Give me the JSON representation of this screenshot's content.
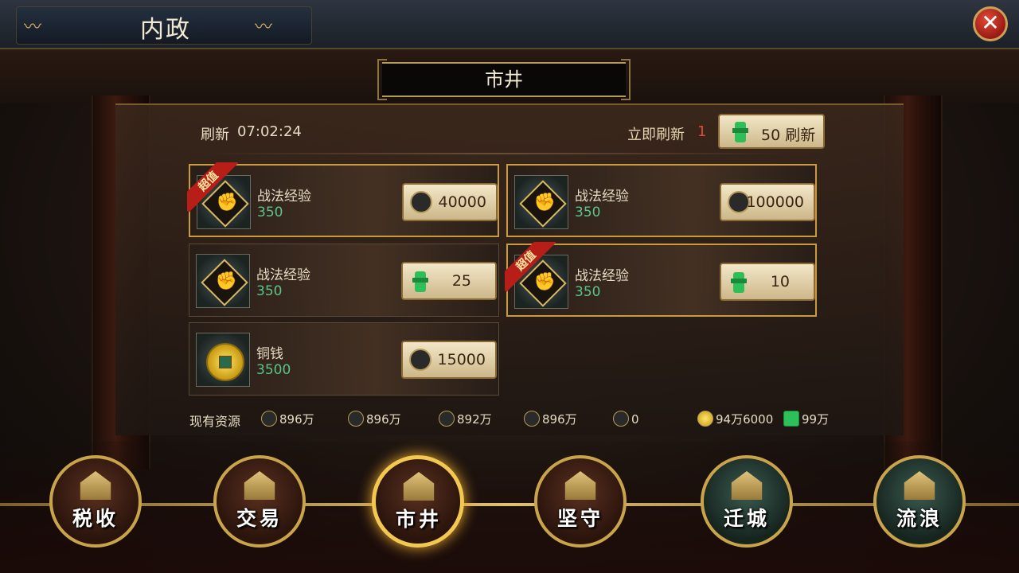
{
  "header": {
    "title": "内政",
    "close_label": "✕"
  },
  "section": {
    "title": "市井"
  },
  "refresh": {
    "label": "刷新",
    "countdown": "07:02:24",
    "instant_label": "立即刷新",
    "instant_count": "1",
    "button_label": "50 刷新"
  },
  "items": [
    {
      "name": "战法经验",
      "qty": "350",
      "price": "40000",
      "currency": "silver",
      "badge": "超值",
      "highlighted": true
    },
    {
      "name": "战法经验",
      "qty": "350",
      "price": "100000",
      "currency": "copper",
      "badge": "",
      "highlighted": true
    },
    {
      "name": "战法经验",
      "qty": "350",
      "price": "25",
      "currency": "jade",
      "badge": "",
      "highlighted": false
    },
    {
      "name": "战法经验",
      "qty": "350",
      "price": "10",
      "currency": "jade",
      "badge": "超值",
      "highlighted": true
    },
    {
      "name": "铜钱",
      "qty": "3500",
      "price": "15000",
      "currency": "silver",
      "badge": "",
      "highlighted": false
    }
  ],
  "resources": {
    "label": "现有资源",
    "values": [
      "896万",
      "896万",
      "892万",
      "896万",
      "0",
      "94万6000",
      "99万"
    ]
  },
  "nav": [
    {
      "label": "税收"
    },
    {
      "label": "交易"
    },
    {
      "label": "市井"
    },
    {
      "label": "坚守"
    },
    {
      "label": "迁城"
    },
    {
      "label": "流浪"
    }
  ]
}
